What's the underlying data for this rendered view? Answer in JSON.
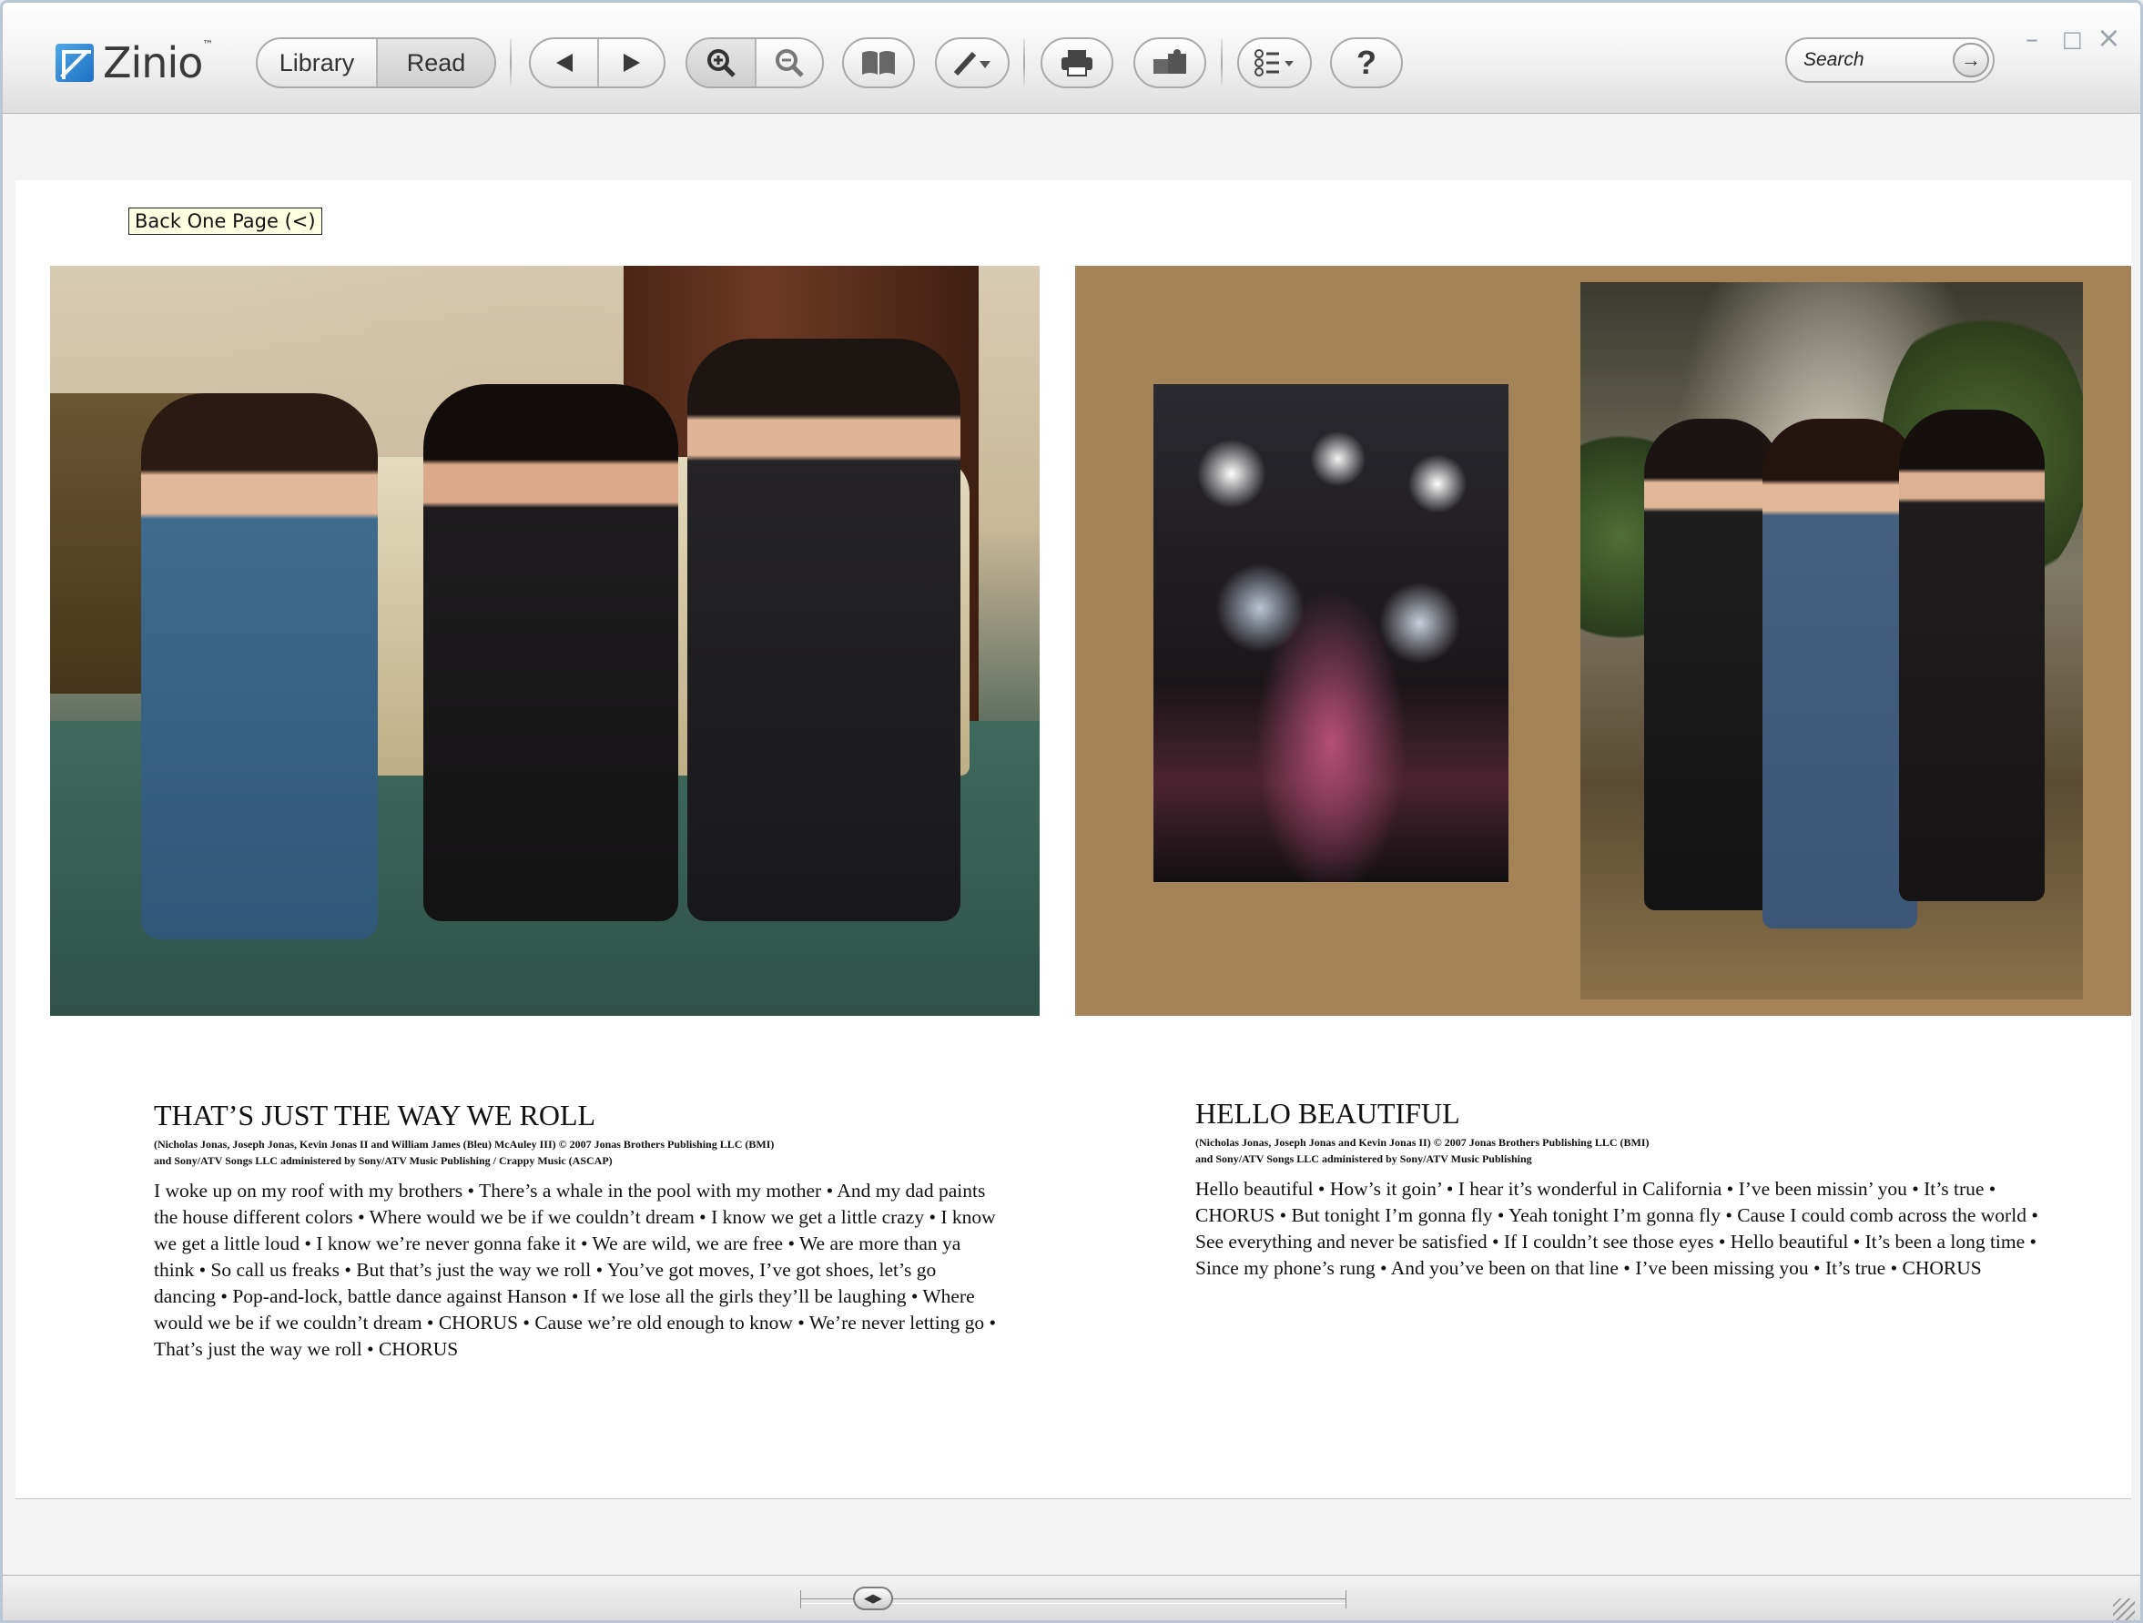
{
  "app": {
    "logo_text": "Zinio",
    "logo_tm": "™"
  },
  "toolbar": {
    "library_label": "Library",
    "read_label": "Read",
    "back_glyph": "◀",
    "forward_glyph": "▶",
    "zoom_in_glyph": "🔍+",
    "zoom_out_glyph": "🔍−",
    "help_glyph": "?",
    "icons": [
      "back-arrow",
      "forward-arrow",
      "zoom-in",
      "zoom-out",
      "book-view",
      "pen-tool",
      "printer",
      "share",
      "options",
      "help"
    ]
  },
  "search": {
    "placeholder": "Search",
    "go_glyph": "→"
  },
  "window_controls": {
    "minimize": "–",
    "maximize": "□",
    "close": "×"
  },
  "tooltip": {
    "text": "Back One Page (<)"
  },
  "songs": [
    {
      "title": "THAT’S JUST THE WAY WE ROLL",
      "credits_line1": "(Nicholas Jonas, Joseph Jonas, Kevin Jonas II and William James (Bleu) McAuley III) © 2007 Jonas Brothers Publishing LLC (BMI)",
      "credits_line2": "and Sony/ATV Songs LLC administered by Sony/ATV Music Publishing / Crappy Music (ASCAP)",
      "lyrics": "I woke up on my roof with my brothers • There’s a whale in the pool with my mother • And my dad paints the house different colors • Where would we be if we couldn’t dream • I know we get a little crazy • I know we get a little loud • I know we’re never gonna fake it • We are wild, we are free • We are more than ya think • So call us freaks • But that’s just the way we roll • You’ve got moves, I’ve got shoes, let’s go dancing • Pop-and-lock, battle dance against Hanson • If we lose all the girls they’ll be laughing • Where would we be if we couldn’t dream • CHORUS • Cause we’re old enough to know • We’re never letting go • That’s just the way we roll • CHORUS"
    },
    {
      "title": "HELLO BEAUTIFUL",
      "credits_line1": "(Nicholas Jonas, Joseph Jonas and Kevin Jonas II) © 2007 Jonas Brothers Publishing LLC (BMI)",
      "credits_line2": "and Sony/ATV Songs LLC administered by Sony/ATV Music Publishing",
      "lyrics": "Hello beautiful • How’s it goin’ • I hear it’s wonderful in California • I’ve been missin’ you • It’s true • CHORUS • But tonight I’m gonna fly • Yeah tonight I’m gonna fly • Cause I could comb across the world • See everything and never be satisfied • If I couldn’t see those eyes • Hello beautiful • It’s been a long time • Since my phone’s rung • And you’ve been on that line • I’ve been missing you • It’s true • CHORUS"
    }
  ],
  "statusbar": {
    "thumb_glyph": "◀▶"
  },
  "colors": {
    "spread_background": "#a58358",
    "tooltip_background": "#ffffe1",
    "window_border": "#b9c6d6"
  }
}
